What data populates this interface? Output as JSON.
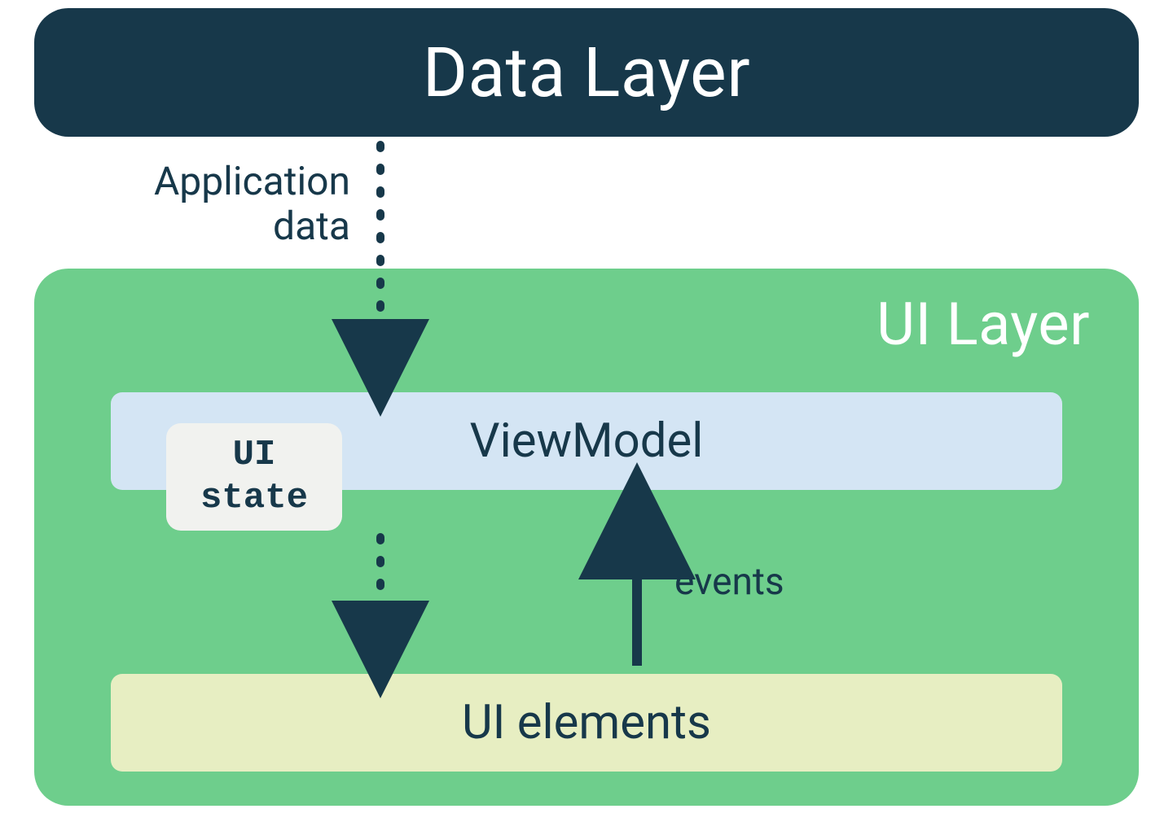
{
  "dataLayer": {
    "label": "Data Layer"
  },
  "uiLayer": {
    "title": "UI Layer"
  },
  "arrows": {
    "appData": "Application\ndata",
    "events": "events"
  },
  "viewModel": {
    "label": "ViewModel"
  },
  "uiState": {
    "label": "UI\nstate"
  },
  "uiElements": {
    "label": "UI elements"
  },
  "colors": {
    "dark": "#17384a",
    "green": "#6ece8c",
    "lightBlue": "#d4e5f4",
    "cream": "#e7eec2",
    "grey": "#f1f2ef"
  }
}
